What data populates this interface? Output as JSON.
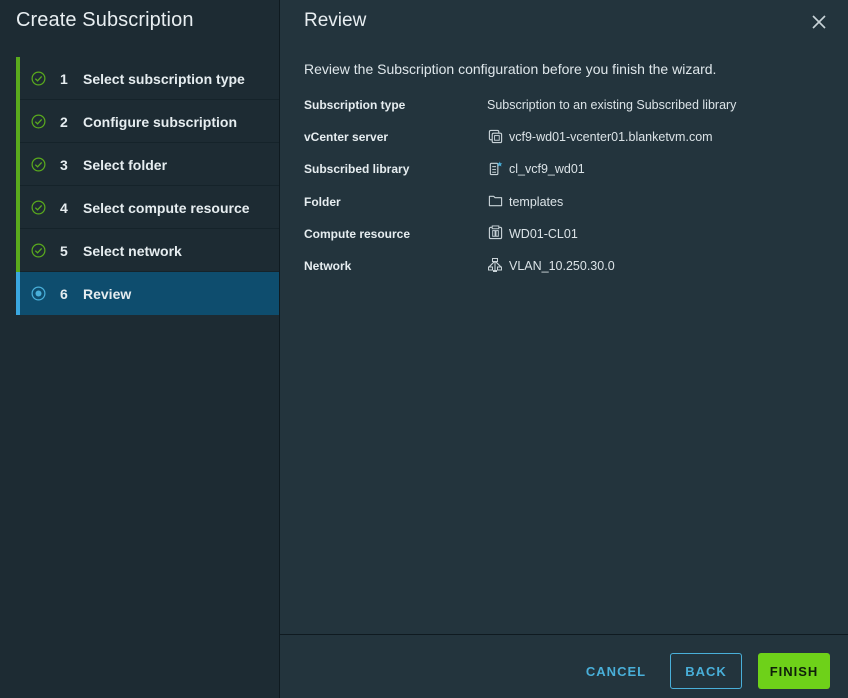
{
  "wizard": {
    "title": "Create Subscription",
    "steps": [
      {
        "number": "1",
        "label": "Select subscription type",
        "status": "complete"
      },
      {
        "number": "2",
        "label": "Configure subscription",
        "status": "complete"
      },
      {
        "number": "3",
        "label": "Select folder",
        "status": "complete"
      },
      {
        "number": "4",
        "label": "Select compute resource",
        "status": "complete"
      },
      {
        "number": "5",
        "label": "Select network",
        "status": "complete"
      },
      {
        "number": "6",
        "label": "Review",
        "status": "active"
      }
    ]
  },
  "review": {
    "title": "Review",
    "intro": "Review the Subscription configuration before you finish the wizard.",
    "fields": [
      {
        "label": "Subscription type",
        "value": "Subscription to an existing Subscribed library",
        "icon": ""
      },
      {
        "label": "vCenter server",
        "value": "vcf9-wd01-vcenter01.blanketvm.com",
        "icon": "vcenter-icon"
      },
      {
        "label": "Subscribed library",
        "value": "cl_vcf9_wd01",
        "icon": "subscribed-library-icon"
      },
      {
        "label": "Folder",
        "value": "templates",
        "icon": "folder-icon"
      },
      {
        "label": "Compute resource",
        "value": "WD01-CL01",
        "icon": "cluster-icon"
      },
      {
        "label": "Network",
        "value": "VLAN_10.250.30.0",
        "icon": "network-icon"
      }
    ]
  },
  "footer": {
    "cancel_label": "CANCEL",
    "back_label": "BACK",
    "finish_label": "FINISH"
  },
  "colors": {
    "complete": "#5aaa1d",
    "active": "#0e4d6e",
    "accent": "#49afd9",
    "finish": "#6ed119"
  }
}
